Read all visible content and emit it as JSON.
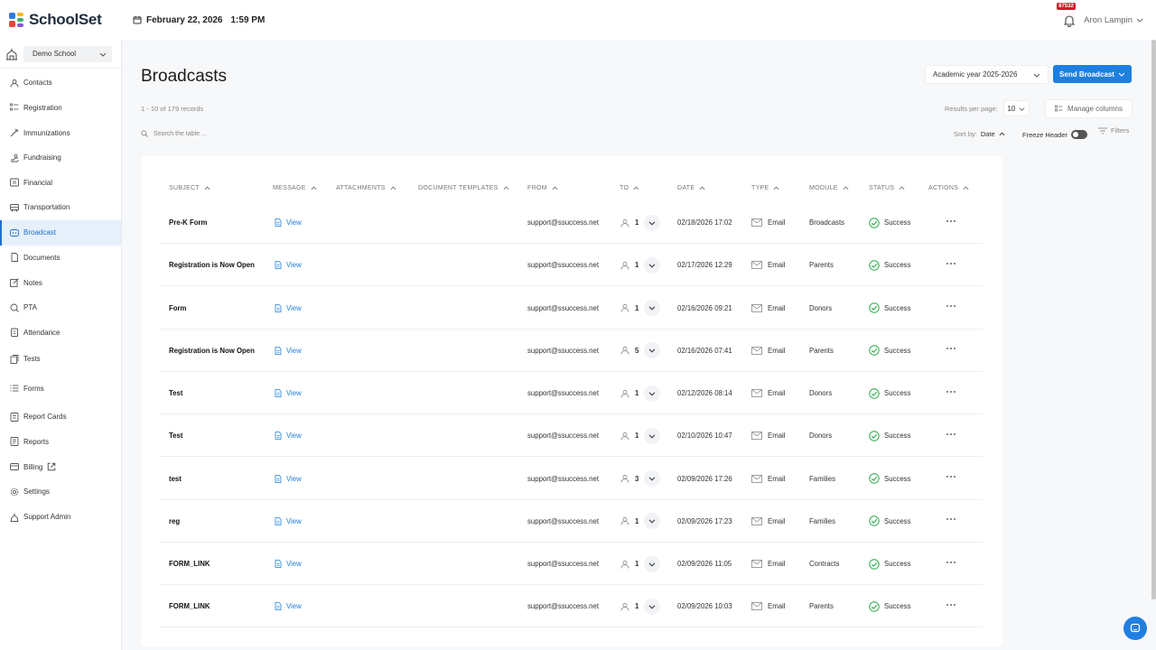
{
  "app": {
    "name": "SchoolSet"
  },
  "topbar": {
    "date": "February 22, 2026",
    "time": "1:59 PM",
    "notification_count": "87532",
    "user_name": "Aron Lampin"
  },
  "sidebar": {
    "school": "Demo School",
    "items": [
      {
        "label": "Contacts",
        "icon": "contacts-icon"
      },
      {
        "label": "Registration",
        "icon": "registration-icon"
      },
      {
        "label": "Immunizations",
        "icon": "syringe-icon"
      },
      {
        "label": "Fundraising",
        "icon": "fundraising-icon"
      },
      {
        "label": "Financial",
        "icon": "financial-icon"
      },
      {
        "label": "Transportation",
        "icon": "bus-icon"
      },
      {
        "label": "Broadcast",
        "icon": "broadcast-icon",
        "active": true
      },
      {
        "label": "Documents",
        "icon": "document-icon"
      },
      {
        "label": "Notes",
        "icon": "note-icon"
      },
      {
        "label": "PTA",
        "icon": "pta-icon"
      },
      {
        "label": "Attendance",
        "icon": "attendance-icon"
      },
      {
        "label": "Tests",
        "icon": "tests-icon"
      },
      {
        "label": "Forms",
        "icon": "forms-icon"
      },
      {
        "label": "Report Cards",
        "icon": "report-card-icon"
      },
      {
        "label": "Reports",
        "icon": "reports-icon"
      },
      {
        "label": "Billing",
        "icon": "billing-icon"
      },
      {
        "label": "Settings",
        "icon": "gear-icon"
      },
      {
        "label": "Support Admin",
        "icon": "support-admin-icon"
      }
    ]
  },
  "page": {
    "title": "Broadcasts",
    "records": "1 - 10 of 179 records",
    "search_placeholder": "Search the table ...",
    "year_select": "Academic year 2025-2026",
    "send_button": "Send Broadcast",
    "results_per_page_label": "Results per page:",
    "results_per_page": "10",
    "manage_columns": "Manage columns",
    "sort_by_label": "Sort by:",
    "sort_by_value": "Date",
    "freeze_header": "Freeze Header",
    "filters": "Filters"
  },
  "table": {
    "columns": [
      "SUBJECT",
      "MESSAGE",
      "ATTACHMENTS",
      "DOCUMENT TEMPLATES",
      "FROM",
      "TO",
      "DATE",
      "TYPE",
      "MODULE",
      "STATUS",
      "ACTIONS"
    ],
    "view_label": "View",
    "rows": [
      {
        "subject": "Pre-K Form",
        "from": "support@ssuccess.net",
        "to": "1",
        "date": "02/18/2026 17:02",
        "type": "Email",
        "module": "Broadcasts",
        "status": "Success"
      },
      {
        "subject": "Registration is Now Open",
        "from": "support@ssuccess.net",
        "to": "1",
        "date": "02/17/2026 12:29",
        "type": "Email",
        "module": "Parents",
        "status": "Success"
      },
      {
        "subject": "Form",
        "from": "support@ssuccess.net",
        "to": "1",
        "date": "02/16/2026 09:21",
        "type": "Email",
        "module": "Donors",
        "status": "Success"
      },
      {
        "subject": "Registration is Now Open",
        "from": "support@ssuccess.net",
        "to": "5",
        "date": "02/16/2026 07:41",
        "type": "Email",
        "module": "Parents",
        "status": "Success"
      },
      {
        "subject": "Test",
        "from": "support@ssuccess.net",
        "to": "1",
        "date": "02/12/2026 08:14",
        "type": "Email",
        "module": "Donors",
        "status": "Success"
      },
      {
        "subject": "Test",
        "from": "support@ssuccess.net",
        "to": "1",
        "date": "02/10/2026 10:47",
        "type": "Email",
        "module": "Donors",
        "status": "Success"
      },
      {
        "subject": "test",
        "from": "support@ssuccess.net",
        "to": "3",
        "date": "02/09/2026 17:26",
        "type": "Email",
        "module": "Families",
        "status": "Success"
      },
      {
        "subject": "reg",
        "from": "support@ssuccess.net",
        "to": "1",
        "date": "02/09/2026 17:23",
        "type": "Email",
        "module": "Families",
        "status": "Success"
      },
      {
        "subject": "FORM_LINK",
        "from": "support@ssuccess.net",
        "to": "1",
        "date": "02/09/2026 11:05",
        "type": "Email",
        "module": "Contracts",
        "status": "Success"
      },
      {
        "subject": "FORM_LINK",
        "from": "support@ssuccess.net",
        "to": "1",
        "date": "02/09/2026 10:03",
        "type": "Email",
        "module": "Parents",
        "status": "Success"
      }
    ]
  },
  "colors": {
    "accent": "#1f7fe0",
    "success": "#2aa84a",
    "badge": "#d11a2a"
  }
}
